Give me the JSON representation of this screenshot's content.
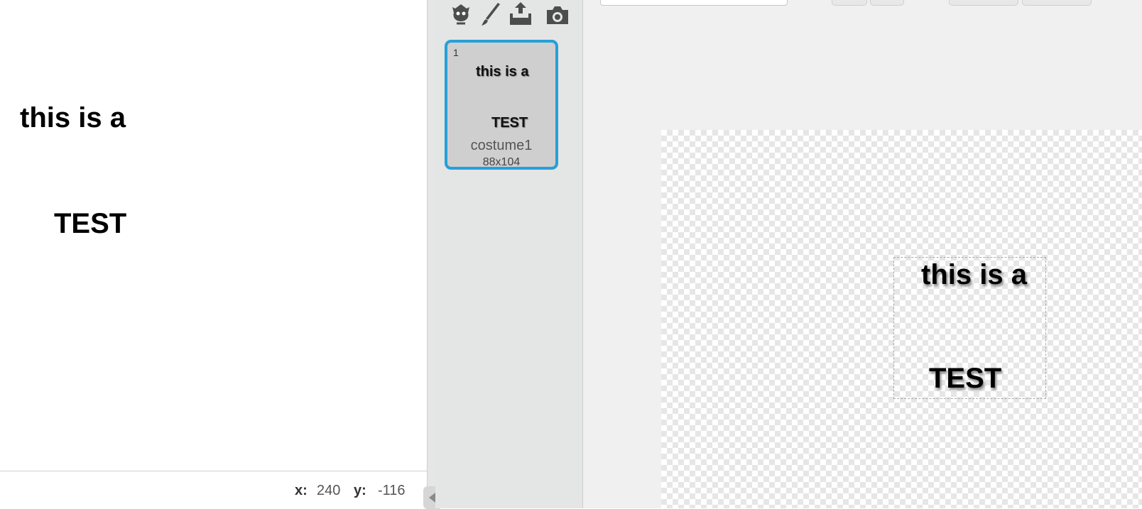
{
  "stage": {
    "text_line1": "this is a",
    "text_line2": "TEST"
  },
  "coordinates": {
    "x_label": "x:",
    "x_value": "240",
    "y_label": "y:",
    "y_value": "-116"
  },
  "costume_tools": [
    {
      "icon": "sprite-library-icon"
    },
    {
      "icon": "paintbrush-icon"
    },
    {
      "icon": "upload-icon"
    },
    {
      "icon": "camera-icon"
    }
  ],
  "costumes": [
    {
      "number": "1",
      "thumb_line1": "this is a",
      "thumb_line2": "TEST",
      "name": "costume1",
      "size": "88x104",
      "selected": true
    }
  ],
  "canvas": {
    "text_line1": "this is a",
    "text_line2": "TEST"
  },
  "colors": {
    "selection_accent": "#25a0d8",
    "panel_bg": "#e4e5e5",
    "editor_bg": "#f0f0f0"
  }
}
